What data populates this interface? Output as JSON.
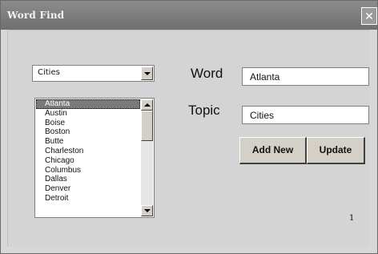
{
  "window": {
    "title": "Word Find",
    "close_glyph": "✕"
  },
  "topic_dropdown": {
    "selected": "Cities"
  },
  "word_list": {
    "items": [
      "Atlanta",
      "Austin",
      "Boise",
      "Boston",
      "Butte",
      "Charleston",
      "Chicago",
      "Columbus",
      "Dallas",
      "Denver",
      "Detroit"
    ],
    "selected_item": "Atlanta"
  },
  "form": {
    "word_label": "Word",
    "word_value": "Atlanta",
    "topic_label": "Topic",
    "topic_value": "Cities"
  },
  "buttons": {
    "add_new": "Add New",
    "update": "Update"
  },
  "record_counter": "1",
  "colors": {
    "titlebar": "#7a7a7a",
    "client_background": "#d4d4d4",
    "selection": "#7a7a7a"
  },
  "icons": {
    "close": "close-icon",
    "dropdown": "chevron-down-icon",
    "scroll_up": "scroll-up-arrow-icon",
    "scroll_down": "scroll-down-arrow-icon"
  }
}
